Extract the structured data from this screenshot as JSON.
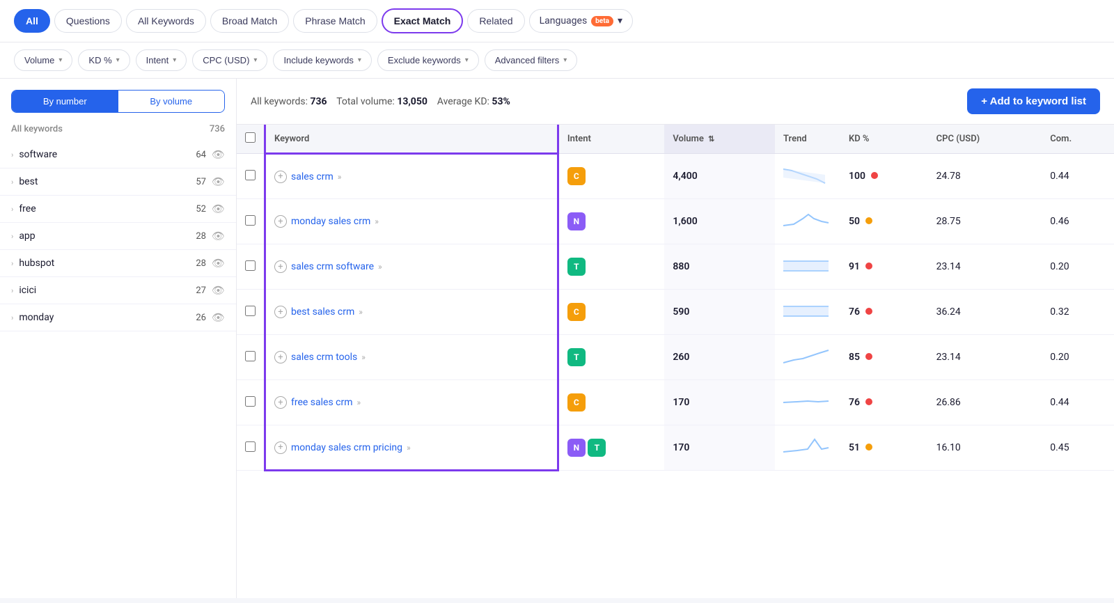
{
  "tabs": [
    {
      "label": "All",
      "id": "all",
      "active": false,
      "special": "all-btn"
    },
    {
      "label": "Questions",
      "id": "questions",
      "active": false
    },
    {
      "label": "All Keywords",
      "id": "all-keywords",
      "active": false
    },
    {
      "label": "Broad Match",
      "id": "broad-match",
      "active": false
    },
    {
      "label": "Phrase Match",
      "id": "phrase-match",
      "active": false
    },
    {
      "label": "Exact Match",
      "id": "exact-match",
      "active": true,
      "special": "exact-match"
    },
    {
      "label": "Related",
      "id": "related",
      "active": false
    }
  ],
  "languages_label": "Languages",
  "beta_label": "beta",
  "filters": [
    {
      "label": "Volume",
      "id": "volume"
    },
    {
      "label": "KD %",
      "id": "kd"
    },
    {
      "label": "Intent",
      "id": "intent"
    },
    {
      "label": "CPC (USD)",
      "id": "cpc"
    },
    {
      "label": "Include keywords",
      "id": "include-keywords"
    },
    {
      "label": "Exclude keywords",
      "id": "exclude-keywords"
    },
    {
      "label": "Advanced filters",
      "id": "advanced-filters"
    }
  ],
  "sort_buttons": [
    {
      "label": "By number",
      "id": "by-number",
      "active": true
    },
    {
      "label": "By volume",
      "id": "by-volume",
      "active": false
    }
  ],
  "sidebar_header": {
    "label": "All keywords",
    "count": "736"
  },
  "sidebar_items": [
    {
      "label": "software",
      "count": "64"
    },
    {
      "label": "best",
      "count": "57"
    },
    {
      "label": "free",
      "count": "52"
    },
    {
      "label": "app",
      "count": "28"
    },
    {
      "label": "hubspot",
      "count": "28"
    },
    {
      "label": "icici",
      "count": "27"
    },
    {
      "label": "monday",
      "count": "26"
    }
  ],
  "summary": {
    "all_keywords_label": "All keywords:",
    "all_keywords_value": "736",
    "total_volume_label": "Total volume:",
    "total_volume_value": "13,050",
    "avg_kd_label": "Average KD:",
    "avg_kd_value": "53%"
  },
  "add_button_label": "+ Add to keyword list",
  "table_headers": [
    {
      "label": "Keyword",
      "id": "keyword"
    },
    {
      "label": "Intent",
      "id": "intent"
    },
    {
      "label": "Volume",
      "id": "volume",
      "sortable": true
    },
    {
      "label": "Trend",
      "id": "trend"
    },
    {
      "label": "KD %",
      "id": "kd"
    },
    {
      "label": "CPC (USD)",
      "id": "cpc"
    },
    {
      "label": "Com.",
      "id": "com"
    }
  ],
  "rows": [
    {
      "keyword": "sales crm",
      "intent": "C",
      "intent_class": "intent-c",
      "volume": "4,400",
      "trend": "down",
      "kd": "100",
      "kd_dot": "dot-red",
      "cpc": "24.78",
      "com": "0.44"
    },
    {
      "keyword": "monday sales crm",
      "intent": "N",
      "intent_class": "intent-n",
      "volume": "1,600",
      "trend": "up-spike",
      "kd": "50",
      "kd_dot": "dot-orange",
      "cpc": "28.75",
      "com": "0.46"
    },
    {
      "keyword": "sales crm software",
      "intent": "T",
      "intent_class": "intent-t",
      "volume": "880",
      "trend": "flat-box",
      "kd": "91",
      "kd_dot": "dot-red",
      "cpc": "23.14",
      "com": "0.20"
    },
    {
      "keyword": "best sales crm",
      "intent": "C",
      "intent_class": "intent-c",
      "volume": "590",
      "trend": "flat-box",
      "kd": "76",
      "kd_dot": "dot-red",
      "cpc": "36.24",
      "com": "0.32"
    },
    {
      "keyword": "sales crm tools",
      "intent": "T",
      "intent_class": "intent-t",
      "volume": "260",
      "trend": "up",
      "kd": "85",
      "kd_dot": "dot-red",
      "cpc": "23.14",
      "com": "0.20"
    },
    {
      "keyword": "free sales crm",
      "intent": "C",
      "intent_class": "intent-c",
      "volume": "170",
      "trend": "flat",
      "kd": "76",
      "kd_dot": "dot-red",
      "cpc": "26.86",
      "com": "0.44"
    },
    {
      "keyword": "monday sales crm pricing",
      "intent_multi": [
        "N",
        "T"
      ],
      "intent_classes": [
        "intent-n",
        "intent-t"
      ],
      "volume": "170",
      "trend": "spike",
      "kd": "51",
      "kd_dot": "dot-orange",
      "cpc": "16.10",
      "com": "0.45"
    }
  ]
}
